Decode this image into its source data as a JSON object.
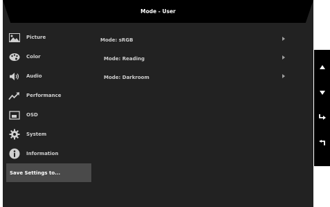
{
  "title": "Mode - User",
  "sidebar": {
    "items": [
      {
        "label": "Picture",
        "icon": "picture-icon"
      },
      {
        "label": "Color",
        "icon": "palette-icon"
      },
      {
        "label": "Audio",
        "icon": "speaker-icon"
      },
      {
        "label": "Performance",
        "icon": "trend-icon"
      },
      {
        "label": "OSD",
        "icon": "osd-icon"
      },
      {
        "label": "System",
        "icon": "gear-icon"
      },
      {
        "label": "Information",
        "icon": "info-icon"
      }
    ],
    "save_label": "Save Settings to..."
  },
  "submenu": {
    "items": [
      {
        "label": "Mode: sRGB"
      },
      {
        "label": "Mode: Reading"
      },
      {
        "label": "Mode: Darkroom"
      }
    ]
  },
  "keys": [
    {
      "icon": "up-triangle-icon"
    },
    {
      "icon": "down-triangle-icon"
    },
    {
      "icon": "enter-icon"
    },
    {
      "icon": "back-icon"
    }
  ],
  "colors": {
    "panel": "#222222",
    "titlebar": "#000000",
    "selected": "#4a4a4a",
    "text": "#d0d0d0"
  }
}
